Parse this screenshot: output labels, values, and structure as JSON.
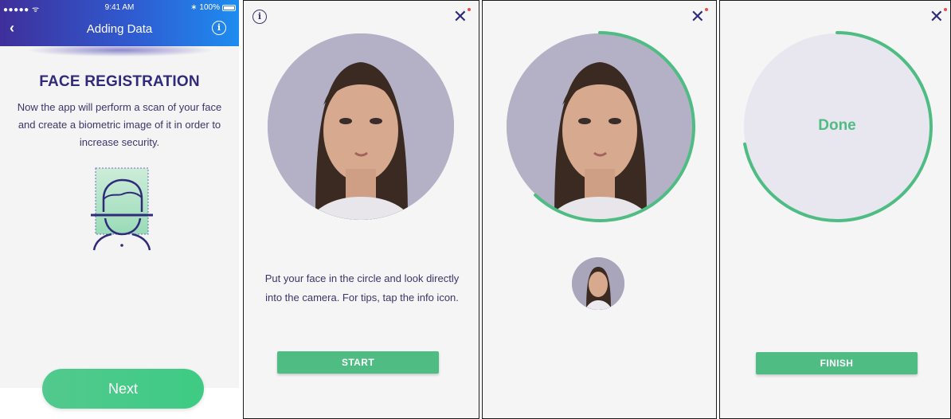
{
  "screen1": {
    "status": {
      "signal": "●●●●● ᯤ",
      "time": "9:41 AM",
      "battery": "∗ 100%"
    },
    "nav": {
      "back": "‹",
      "title": "Adding Data",
      "info": "i"
    },
    "heading": "FACE REGISTRATION",
    "description": "Now the app will perform a scan of your face and create a biometric image of it in order to increase security.",
    "next_label": "Next"
  },
  "screen2": {
    "info": "i",
    "close": "✕",
    "instruction": "Put your face in the circle and look directly into the camera. For tips, tap the info icon.",
    "start_label": "START"
  },
  "screen3": {
    "close": "✕",
    "progress": 0.62
  },
  "screen4": {
    "close": "✕",
    "done_label": "Done",
    "finish_label": "FINISH",
    "progress": 0.72
  },
  "colors": {
    "accent_green": "#4fbd83",
    "navy": "#2f2a7a",
    "header_start": "#3f2f9a",
    "header_end": "#1e8cf0"
  }
}
